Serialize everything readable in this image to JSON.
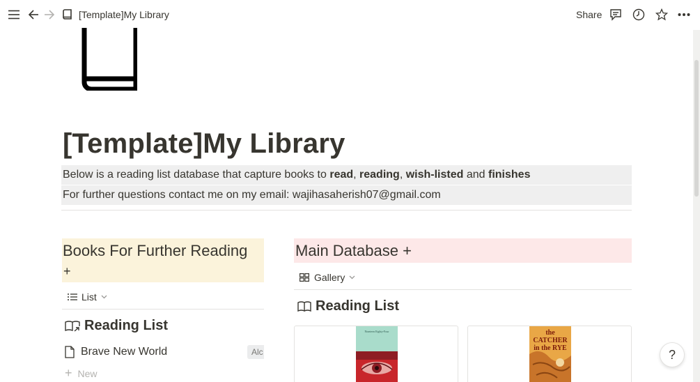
{
  "topbar": {
    "title": "[Template]My Library",
    "share_label": "Share"
  },
  "icons": {
    "menu": "menu-icon",
    "back": "arrow-left-icon",
    "forward": "arrow-right-icon",
    "page": "book-icon",
    "comments": "comment-icon",
    "history": "clock-icon",
    "favorite": "star-icon",
    "more": "more-icon"
  },
  "page": {
    "title": "[Template]My Library",
    "line1": {
      "prefix": "Below is a reading list database that capture books to ",
      "w1": "read",
      "sep1": ", ",
      "w2": "reading",
      "sep2": ", ",
      "w3": "wish-listed",
      "sep3": " and ",
      "w4": "finishes"
    },
    "line2": "For further questions contact me on my email: wajihasaherish07@gmail.com"
  },
  "left": {
    "header": "Books For Further Reading",
    "header_plus": "+",
    "view_label": "List",
    "section_title": "Reading List",
    "rows": [
      {
        "title": "Brave New World",
        "tag": "Alc"
      }
    ],
    "new_label": "New"
  },
  "right": {
    "header": "Main Database +",
    "view_label": "Gallery",
    "section_title": "Reading List",
    "cards": [
      {
        "cover_title": "Nineteen Eighty-Four"
      },
      {
        "cover_title": "the CATCHER in the RYE"
      }
    ]
  },
  "help_label": "?",
  "colors": {
    "left_header_bg": "#fbf3db",
    "right_header_bg": "#fde8e8",
    "callout_bg": "#efefef"
  }
}
